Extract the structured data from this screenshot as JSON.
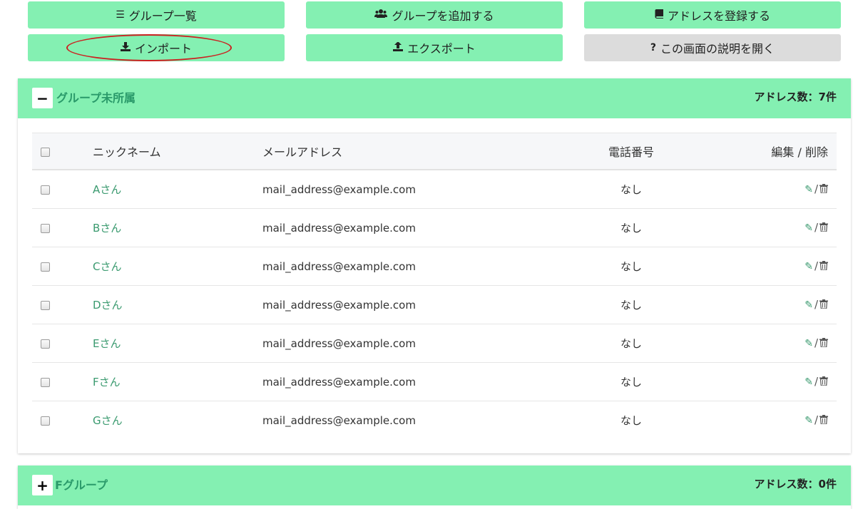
{
  "toolbar": {
    "group_list": {
      "icon": "list-icon",
      "label": "グループ一覧"
    },
    "add_group": {
      "icon": "users-icon",
      "label": "グループを追加する"
    },
    "register_address": {
      "icon": "book-icon",
      "label": "アドレスを登録する"
    },
    "import": {
      "icon": "download-icon",
      "label": "インポート"
    },
    "export": {
      "icon": "upload-icon",
      "label": "エクスポート"
    },
    "help": {
      "icon": "question-icon",
      "label": "この画面の説明を開く"
    }
  },
  "groups": [
    {
      "toggle": "−",
      "name": "グループ未所属",
      "count_label": "アドレス数：7件",
      "columns": {
        "nickname": "ニックネーム",
        "email": "メールアドレス",
        "phone": "電話番号",
        "actions": "編集 / 削除"
      },
      "rows": [
        {
          "nickname": "Aさん",
          "email": "mail_address@example.com",
          "phone": "なし"
        },
        {
          "nickname": "Bさん",
          "email": "mail_address@example.com",
          "phone": "なし"
        },
        {
          "nickname": "Cさん",
          "email": "mail_address@example.com",
          "phone": "なし"
        },
        {
          "nickname": "Dさん",
          "email": "mail_address@example.com",
          "phone": "なし"
        },
        {
          "nickname": "Eさん",
          "email": "mail_address@example.com",
          "phone": "なし"
        },
        {
          "nickname": "Fさん",
          "email": "mail_address@example.com",
          "phone": "なし"
        },
        {
          "nickname": "Gさん",
          "email": "mail_address@example.com",
          "phone": "なし"
        }
      ]
    },
    {
      "toggle": "+",
      "name": "Fグループ",
      "count_label": "アドレス数：0件"
    }
  ],
  "row_actions": {
    "separator": "/"
  },
  "colors": {
    "accent": "#84f0b2",
    "link": "#3a9a6f",
    "highlight": "#cc2020"
  }
}
